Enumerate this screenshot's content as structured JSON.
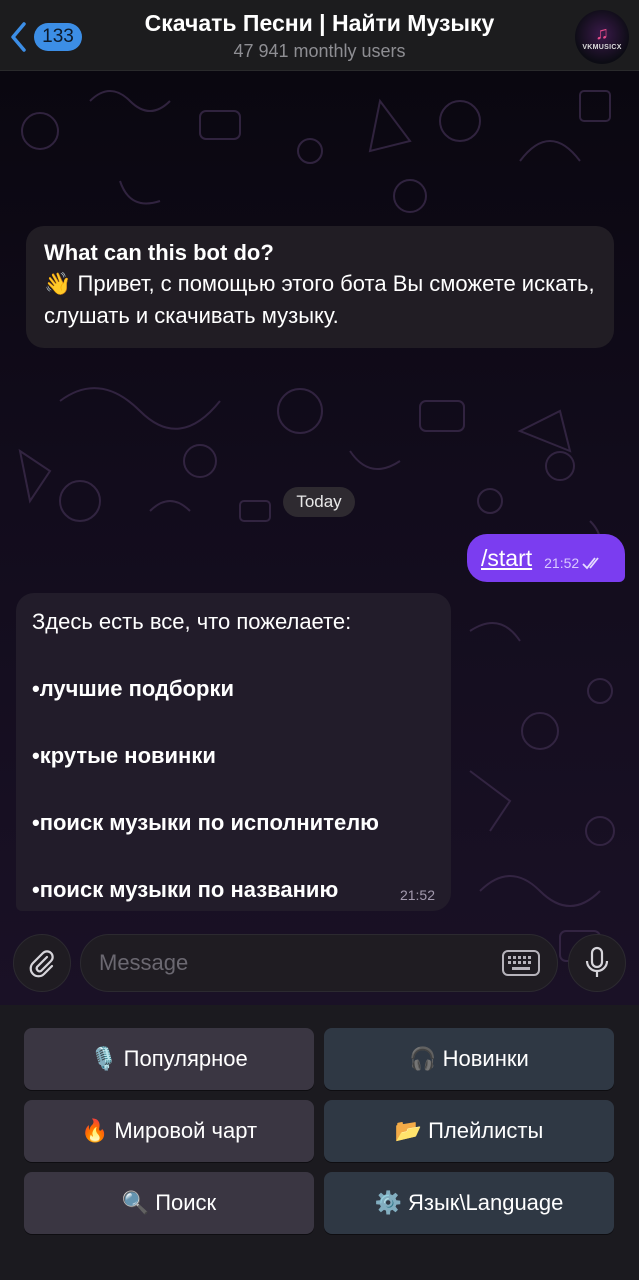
{
  "header": {
    "back_count": "133",
    "title": "Скачать Песни | Найти Музыку",
    "subtitle": "47 941 monthly users",
    "avatar_text": "VKMUSICX"
  },
  "intro": {
    "title": "What can this bot do?",
    "emoji": "👋",
    "text": "Привет, с помощью этого бота Вы сможете искать, слушать и скачивать музыку."
  },
  "date_separator": "Today",
  "outgoing": {
    "text": "/start",
    "time": "21:52"
  },
  "incoming": {
    "first_line": "Здесь есть все, что пожелаете:",
    "items": [
      "•лучшие подборки",
      "•крутые новинки",
      "•поиск музыки по исполнителю",
      "•поиск музыки  по названию"
    ],
    "time": "21:52"
  },
  "input": {
    "placeholder": "Message"
  },
  "keyboard": {
    "buttons": [
      {
        "icon": "🎙️",
        "label": "Популярное"
      },
      {
        "icon": "🎧",
        "label": "Новинки"
      },
      {
        "icon": "🔥",
        "label": "Мировой чарт"
      },
      {
        "icon": "📂",
        "label": "Плейлисты"
      },
      {
        "icon": "🔍",
        "label": "Поиск"
      },
      {
        "icon": "⚙️",
        "label": "Язык\\Language"
      }
    ]
  },
  "colors": {
    "accent": "#3c8ee6",
    "outgoing_bubble": "#7b3df0",
    "incoming_bubble": "#221c2a"
  }
}
